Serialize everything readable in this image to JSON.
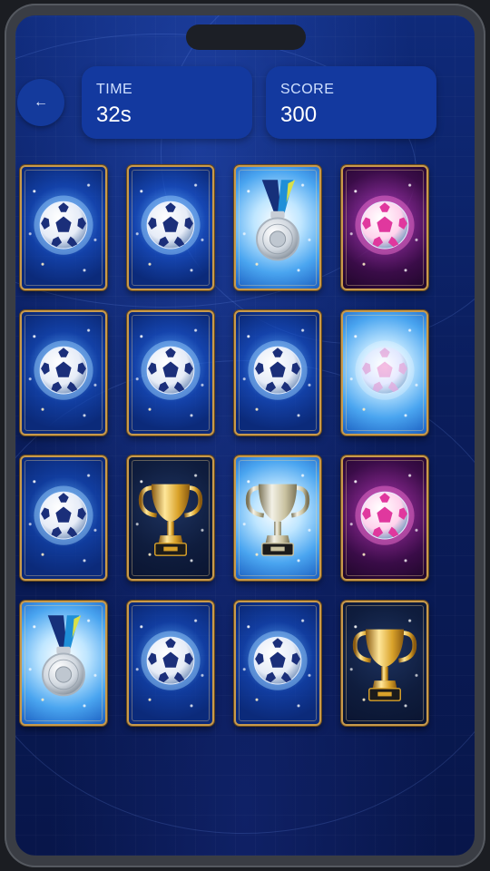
{
  "stats": {
    "time_label": "TIME",
    "time_value": "32s",
    "score_label": "SCORE",
    "score_value": "300"
  },
  "back_button": {
    "icon": "arrow-left-icon",
    "glyph": "←"
  },
  "colors": {
    "panel": "#13399f",
    "background": "#0a1d5c",
    "card_border": "#c89a4c"
  },
  "cards": [
    {
      "face": "ball",
      "bg": "blue"
    },
    {
      "face": "ball",
      "bg": "blue"
    },
    {
      "face": "medal",
      "bg": "light"
    },
    {
      "face": "pink-ball",
      "bg": "pink"
    },
    {
      "face": "ball",
      "bg": "blue"
    },
    {
      "face": "ball",
      "bg": "blue"
    },
    {
      "face": "ball",
      "bg": "blue"
    },
    {
      "face": "faded-ball",
      "bg": "light"
    },
    {
      "face": "ball",
      "bg": "blue"
    },
    {
      "face": "trophy",
      "bg": "dark"
    },
    {
      "face": "silver-trophy",
      "bg": "light"
    },
    {
      "face": "pink-ball",
      "bg": "pink"
    },
    {
      "face": "medal",
      "bg": "light"
    },
    {
      "face": "ball",
      "bg": "blue"
    },
    {
      "face": "ball",
      "bg": "blue"
    },
    {
      "face": "trophy",
      "bg": "dark"
    }
  ]
}
